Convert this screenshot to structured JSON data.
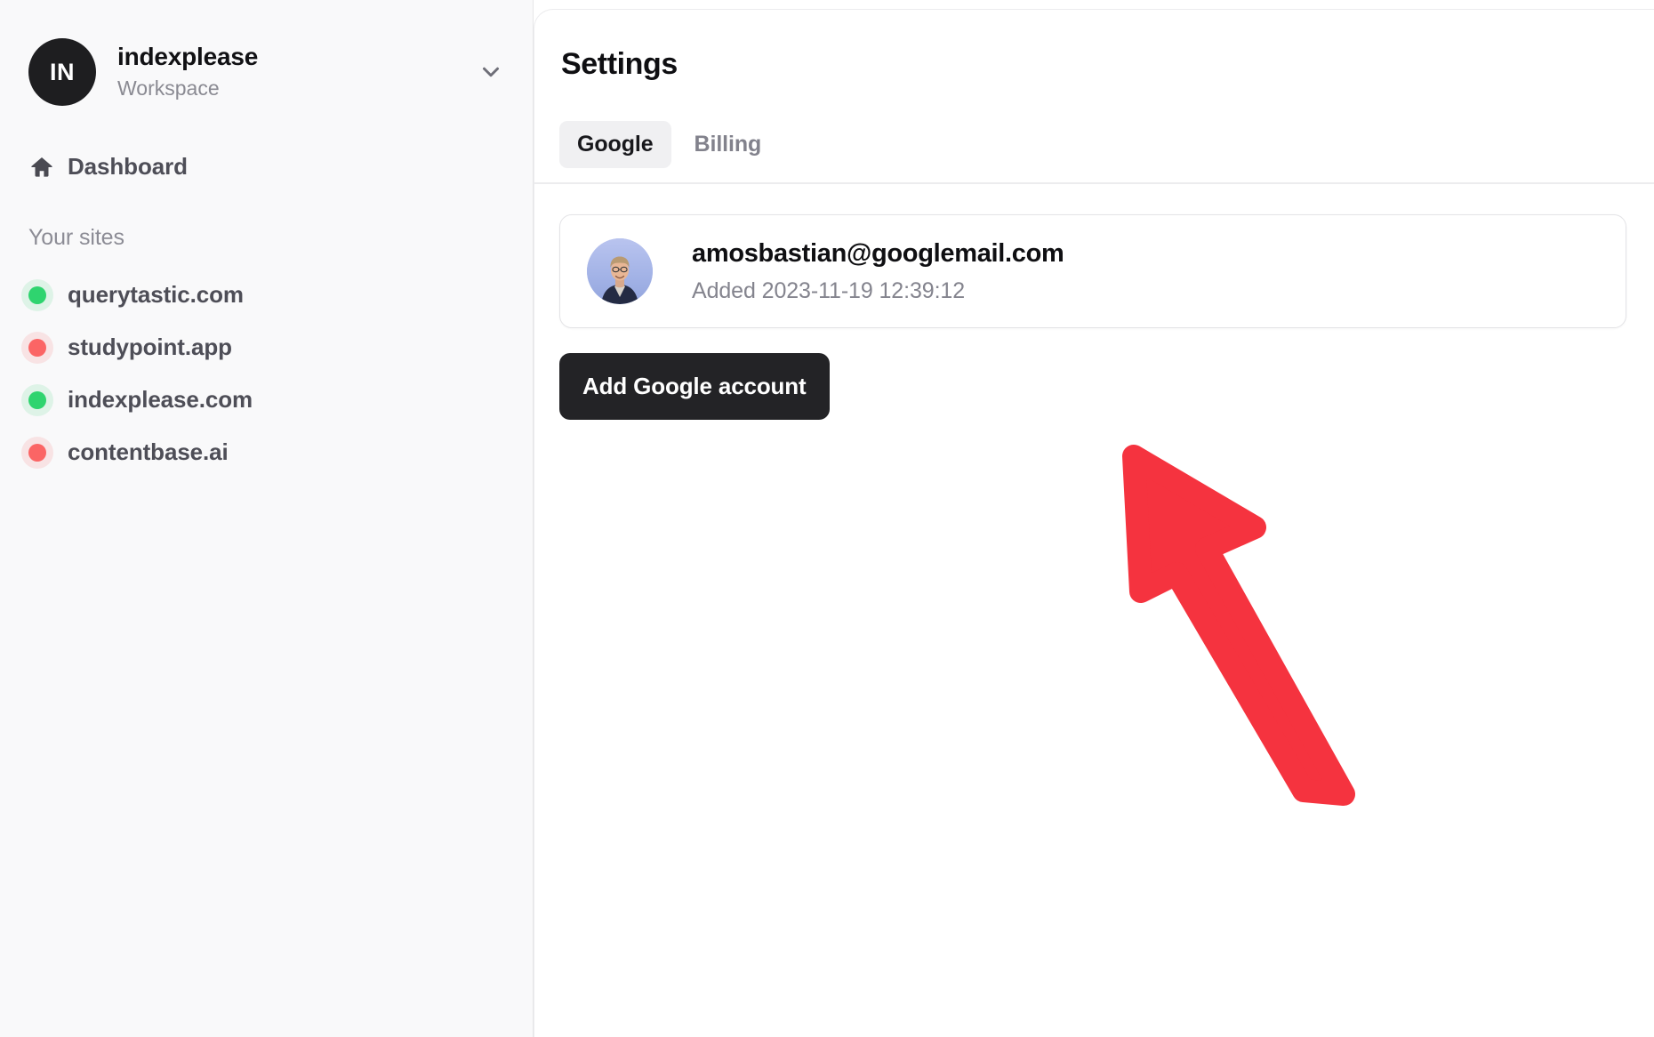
{
  "sidebar": {
    "workspace": {
      "initials": "IN",
      "name": "indexplease",
      "subtitle": "Workspace",
      "chevron_icon": "chevron-down-icon"
    },
    "nav": [
      {
        "label": "Dashboard",
        "icon": "home-icon"
      }
    ],
    "section_label": "Your sites",
    "sites": [
      {
        "label": "querytastic.com",
        "status": "green",
        "status_color": "#2fd46f"
      },
      {
        "label": "studypoint.app",
        "status": "red",
        "status_color": "#fb6565"
      },
      {
        "label": "indexplease.com",
        "status": "green",
        "status_color": "#2fd46f"
      },
      {
        "label": "contentbase.ai",
        "status": "red",
        "status_color": "#fb6565"
      }
    ]
  },
  "main": {
    "title": "Settings",
    "tabs": [
      {
        "label": "Google",
        "active": true
      },
      {
        "label": "Billing",
        "active": false
      }
    ],
    "account": {
      "email": "amosbastian@googlemail.com",
      "added": "Added 2023-11-19 12:39:12",
      "avatar_icon": "user-photo-avatar"
    },
    "add_account_button": "Add Google account"
  },
  "annotation": {
    "arrow_icon": "cursor-arrow-pointer",
    "color": "#f5333f"
  }
}
